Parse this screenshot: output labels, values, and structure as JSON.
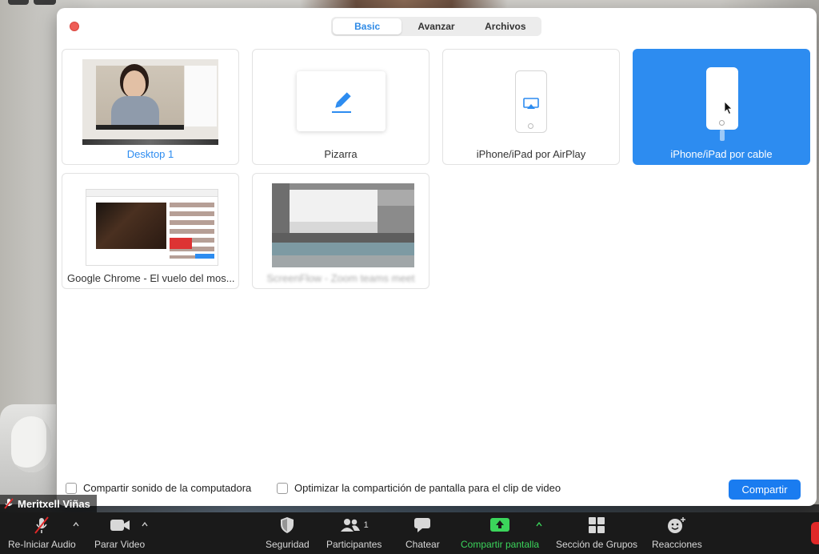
{
  "participant": {
    "name": "Meritxell Viñas"
  },
  "dialog": {
    "tabs": [
      {
        "label": "Basic",
        "active": true
      },
      {
        "label": "Avanzar",
        "active": false
      },
      {
        "label": "Archivos",
        "active": false
      }
    ],
    "sources": [
      {
        "label": "Desktop 1",
        "icon": "desktop-thumbnail"
      },
      {
        "label": "Pizarra",
        "icon": "pencil-icon"
      },
      {
        "label": "iPhone/iPad por AirPlay",
        "icon": "airplay-icon"
      },
      {
        "label": "iPhone/iPad por cable",
        "icon": "iphone-cable-icon",
        "selected": true
      },
      {
        "label": "Google Chrome - El vuelo del mos...",
        "icon": "chrome-window-thumbnail"
      },
      {
        "label": "ScreenFlow - Zoom teams meet",
        "icon": "blurred-window-thumbnail"
      }
    ],
    "options": {
      "share_sound": "Compartir sonido de la computadora",
      "optimize_video": "Optimizar la compartición de pantalla para el clip de video"
    },
    "share_button": "Compartir"
  },
  "toolbar": {
    "audio": "Re-Iniciar Audio",
    "video": "Parar Video",
    "security": "Seguridad",
    "participants": "Participantes",
    "participants_count": "1",
    "chat": "Chatear",
    "share_screen": "Compartir pantalla",
    "breakout": "Sección de Grupos",
    "reactions": "Reacciones"
  },
  "colors": {
    "accent": "#2d8cf0",
    "share_green": "#3bd55b",
    "close_red": "#ee5d56"
  }
}
